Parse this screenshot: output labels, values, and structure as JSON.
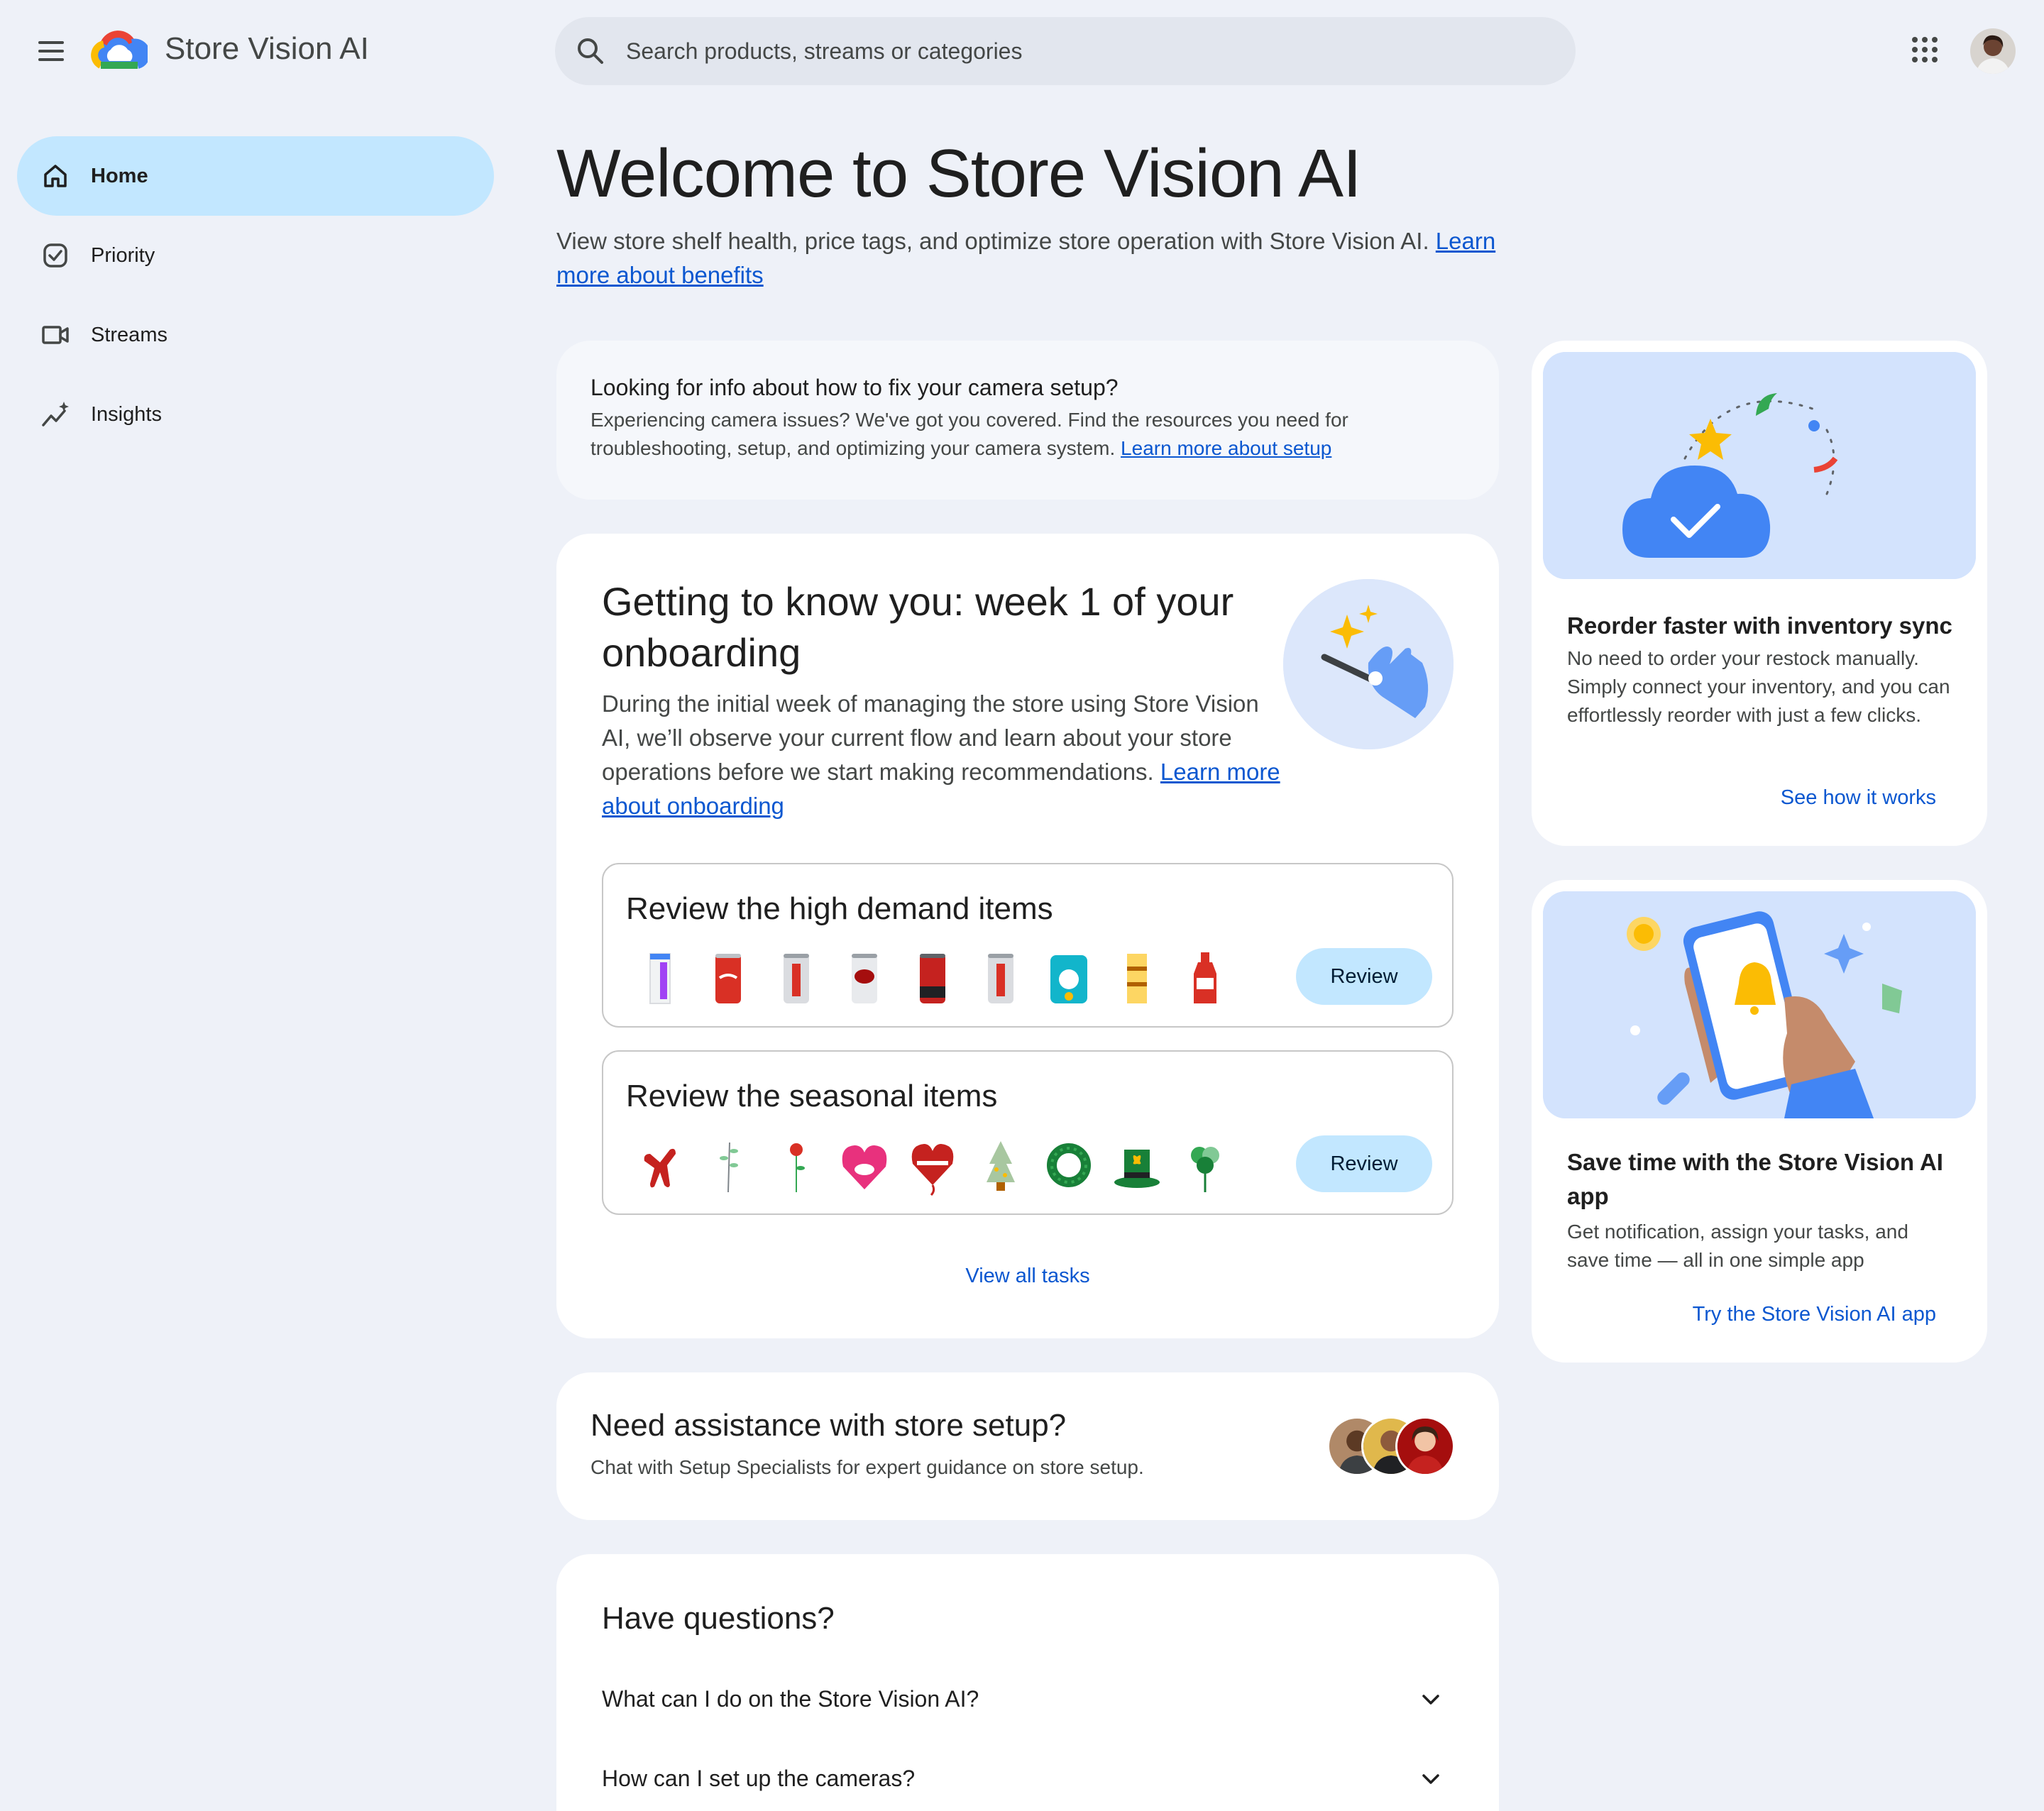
{
  "header": {
    "app_title": "Store Vision AI",
    "search_placeholder": "Search products, streams or categories"
  },
  "sidebar": {
    "items": [
      {
        "label": "Home",
        "icon": "home-icon",
        "active": true
      },
      {
        "label": "Priority",
        "icon": "check-circle-icon",
        "active": false
      },
      {
        "label": "Streams",
        "icon": "video-camera-icon",
        "active": false
      },
      {
        "label": "Insights",
        "icon": "trending-up-icon",
        "active": false
      }
    ]
  },
  "welcome": {
    "title": "Welcome to Store Vision AI",
    "subtitle": "View store shelf health, price tags, and optimize store operation with Store Vision AI.",
    "link": "Learn more about benefits"
  },
  "camera_info": {
    "title": "Looking for info about how to fix your camera setup?",
    "body": "Experiencing camera issues? We've got you covered. Find the resources you need for troubleshooting, setup, and optimizing your camera system.",
    "link": "Learn more about setup"
  },
  "onboarding": {
    "title": "Getting to know you: week 1 of your onboarding",
    "body": "During the initial week of managing the store using Store Vision AI, we’ll observe your current flow and learn about your store operations before we start making recommendations.",
    "link": "Learn more about onboarding",
    "tasks": [
      {
        "title": "Review the high demand items",
        "button": "Review",
        "items": [
          "parmalat milk",
          "Coca-Cola can",
          "Diet Coke can",
          "Dr Pepper can",
          "Coca-Cola can",
          "Diet Coke can",
          "Angel Soft toilet paper",
          "Twix box",
          "ketchup bottle"
        ]
      },
      {
        "title": "Review the seasonal items",
        "button": "Review",
        "items": [
          "balloon dog",
          "olive branch",
          "red rose",
          "heart candy box",
          "heart balloon",
          "mini christmas tree",
          "wreath",
          "leprechaun hat",
          "shamrock bouquet"
        ]
      }
    ],
    "view_all": "View all tasks"
  },
  "assistance": {
    "title": "Need assistance with store setup?",
    "body": "Chat with Setup Specialists for expert guidance on store setup."
  },
  "faq": {
    "title": "Have questions?",
    "questions": [
      "What can I do on the Store Vision AI?",
      "How can I set up the cameras?"
    ]
  },
  "side_cards": [
    {
      "title": "Reorder faster with inventory sync",
      "body": "No need to order your restock manually. Simply connect your inventory, and you can effortlessly reorder with just a few clicks.",
      "link": "See how it works"
    },
    {
      "title": "Save time with the Store Vision AI app",
      "body": "Get notification, assign your tasks, and save time — all in one simple app",
      "link": "Try the Store Vision AI app"
    }
  ],
  "colors": {
    "background": "#eef1f8",
    "active_nav": "#c2e7ff",
    "link": "#0b57d0",
    "illustration_bg": "#d3e3fd"
  }
}
